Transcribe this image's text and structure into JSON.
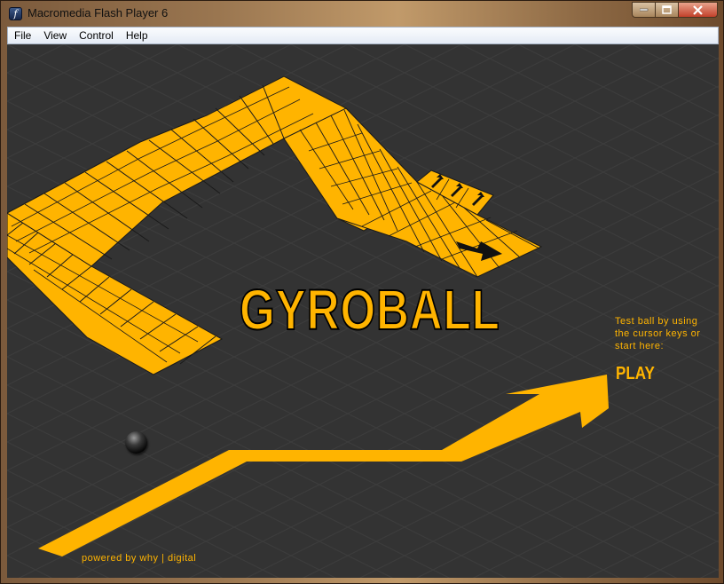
{
  "window": {
    "title": "Macromedia Flash Player 6",
    "app_icon": "flash-icon",
    "controls": {
      "minimize": "minimize-icon",
      "maximize": "maximize-icon",
      "close": "close-icon"
    }
  },
  "menubar": {
    "items": [
      "File",
      "View",
      "Control",
      "Help"
    ]
  },
  "game": {
    "title": "GYROBALL",
    "hint": "Test ball by using the cursor keys or start here:",
    "play_label": "PLAY",
    "credit": "powered by why | digital",
    "colors": {
      "accent": "#ffb400",
      "background": "#333333",
      "grid_line": "#3c3c3c",
      "ball": "#111111"
    }
  }
}
